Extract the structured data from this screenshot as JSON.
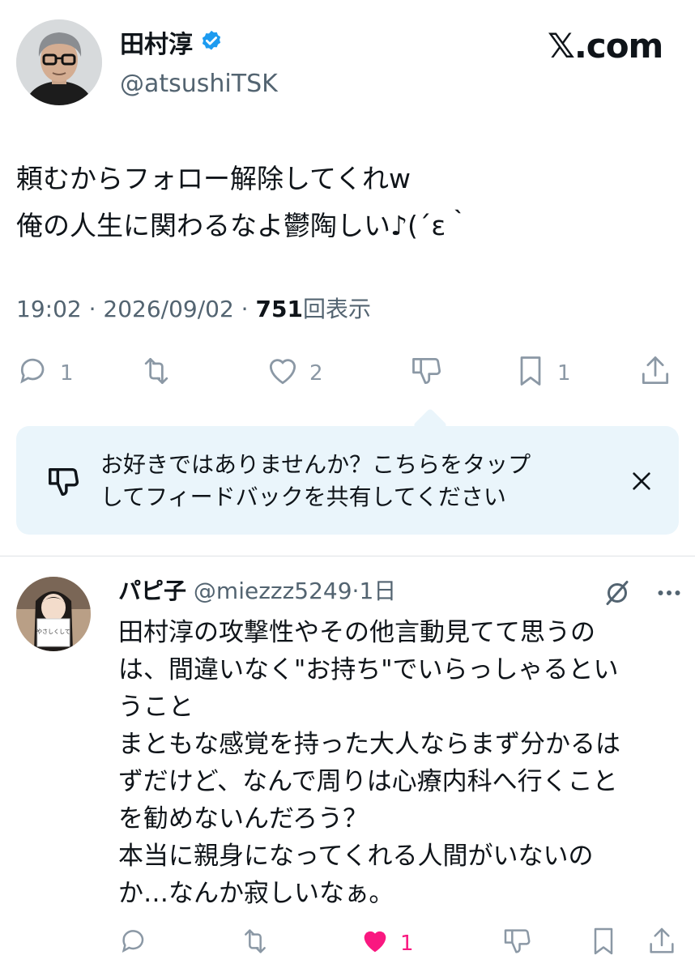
{
  "author": {
    "display_name": "田村淳",
    "handle": "@atsushiTSK"
  },
  "site_logo": "𝕏.com",
  "tweet": {
    "text": "頼むからフォロー解除してくれw\n俺の人生に関わるなよ鬱陶しい♪(´ε｀",
    "time": "19:02 · 2026/09/02 · ",
    "views_count": "751",
    "views_label": "回表示",
    "reply_count": "1",
    "retweet_count": "",
    "like_count": "2",
    "bookmark_count": "1"
  },
  "feedback": {
    "text": "お好きではありませんか？こちらをタップ\nしてフィードバックを共有してください"
  },
  "reply": {
    "display_name": "パピ子",
    "handle": " @miezzz5249",
    "age": "·1日",
    "avatar_sign_text": "やさしくして",
    "text": "田村淳の攻撃性やその他言動見てて思うの\nは、間違いなく\"お持ち\"でいらっしゃるとい\nうこと\nまともな感覚を持った大人ならまず分かるは\nずだけど、なんで周りは心療内科へ行くこと\nを勧めないんだろう？\n本当に親身になってくれる人間がいないの\nか…なんか寂しいなぁ。",
    "like_count": "1"
  },
  "colors": {
    "text": "#0f1419",
    "muted": "#536471",
    "icon": "#8b98a5",
    "verified": "#1d9bf0",
    "like": "#f91880",
    "feedback_bg": "#eaf5fb"
  },
  "icons": [
    "verified-badge-icon",
    "reply-icon",
    "retweet-icon",
    "like-icon",
    "dislike-icon",
    "bookmark-icon",
    "share-icon",
    "close-icon",
    "grok-icon",
    "more-icon"
  ]
}
